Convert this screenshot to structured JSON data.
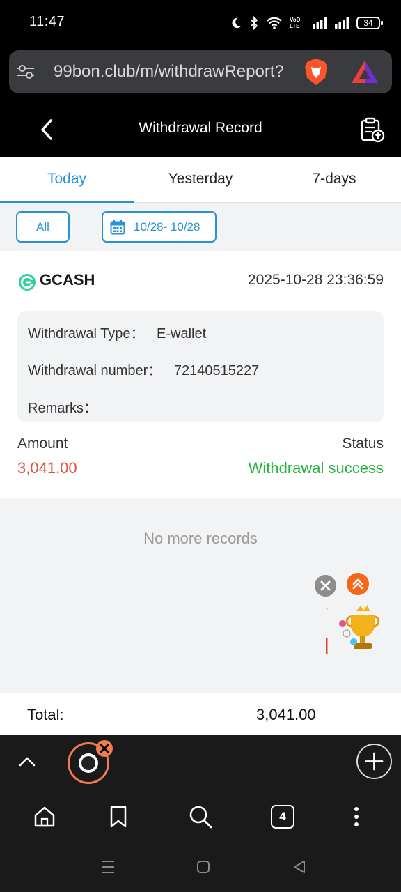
{
  "status_bar": {
    "time": "11:47",
    "network_label": "VoD LTE",
    "battery": "34"
  },
  "browser": {
    "url": "99bon.club/m/withdrawReport?",
    "tab_count": "4"
  },
  "header": {
    "title": "Withdrawal Record"
  },
  "tabs": [
    {
      "label": "Today",
      "active": true
    },
    {
      "label": "Yesterday",
      "active": false
    },
    {
      "label": "7-days",
      "active": false
    }
  ],
  "filters": {
    "all_label": "All",
    "date_range": "10/28- 10/28"
  },
  "record": {
    "method": "GCASH",
    "datetime": "2025-10-28 23:36:59",
    "type_label": "Withdrawal Type：",
    "type_value": "E-wallet",
    "number_label": "Withdrawal number：",
    "number_value": "72140515227",
    "remarks_label": "Remarks：",
    "amount_label": "Amount",
    "amount_value": "3,041.00",
    "status_label": "Status",
    "status_value": "Withdrawal success"
  },
  "list_end_text": "No more records",
  "total": {
    "label": "Total:",
    "value": "3,041.00"
  },
  "colors": {
    "accent": "#2a92d4",
    "amount": "#e05337",
    "success": "#22b33f"
  }
}
